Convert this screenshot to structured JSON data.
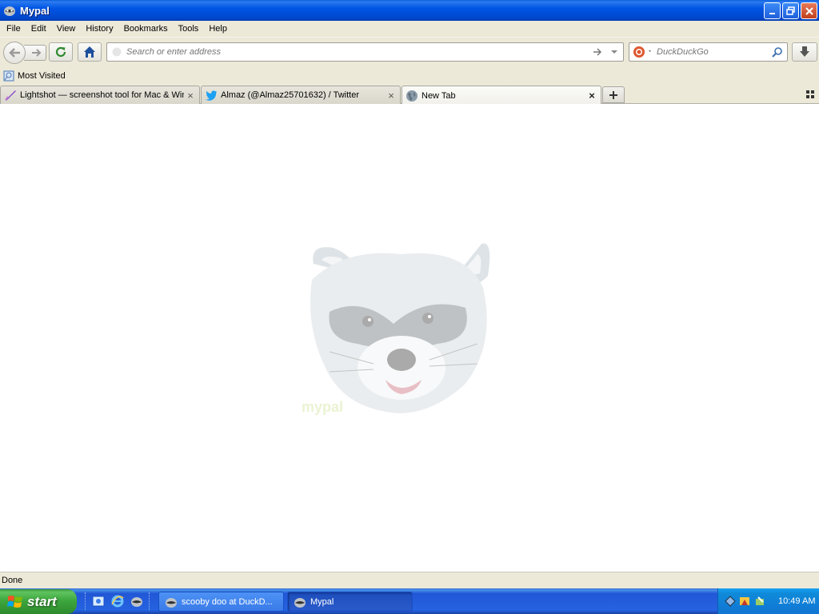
{
  "window": {
    "title": "Mypal"
  },
  "menu": [
    "File",
    "Edit",
    "View",
    "History",
    "Bookmarks",
    "Tools",
    "Help"
  ],
  "navbar": {
    "url_placeholder": "Search or enter address",
    "search_placeholder": "DuckDuckGo"
  },
  "bookmarks": {
    "most_visited": "Most Visited"
  },
  "tabs": [
    {
      "label": "Lightshot — screenshot tool for Mac & Win",
      "icon": "lightshot-icon"
    },
    {
      "label": "Almaz (@Almaz25701632) / Twitter",
      "icon": "twitter-icon"
    },
    {
      "label": "New Tab",
      "icon": "globe-icon",
      "selected": true
    }
  ],
  "content": {
    "watermark_text": "mypal"
  },
  "status": {
    "text": "Done"
  },
  "taskbar": {
    "start_label": "start",
    "buttons": [
      {
        "label": "scooby doo at DuckD...",
        "active": false
      },
      {
        "label": "Mypal",
        "active": true
      }
    ],
    "clock": "10:49 AM"
  },
  "colors": {
    "titlebar": "#0054e3",
    "chrome": "#ece9d8",
    "taskbar": "#245edb",
    "start": "#3ea73e"
  }
}
